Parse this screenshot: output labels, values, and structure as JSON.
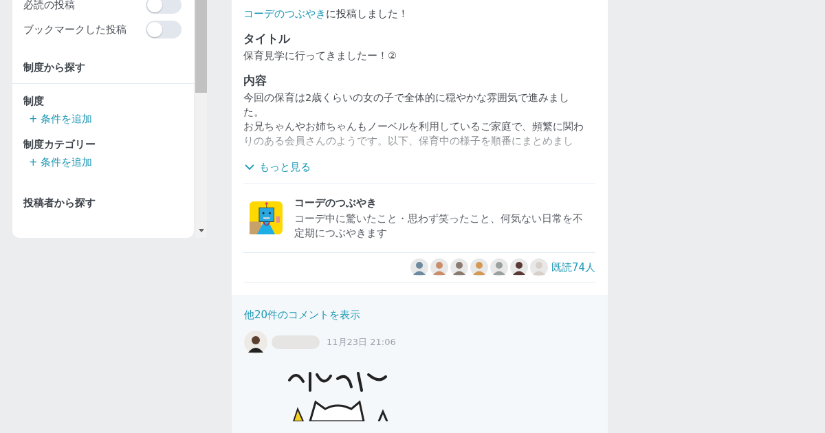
{
  "sidebar": {
    "toggles": [
      {
        "label": "必読の投稿",
        "on": false
      },
      {
        "label": "ブックマークした投稿",
        "on": false
      }
    ],
    "sections": [
      {
        "heading": "制度から探す",
        "filters": [
          {
            "label": "制度",
            "add_link": "+ 条件を追加"
          },
          {
            "label": "制度カテゴリー",
            "add_link": "+ 条件を追加"
          }
        ]
      },
      {
        "heading": "投稿者から探す"
      }
    ]
  },
  "post": {
    "channel_link": "コーデのつぶやき",
    "posted_text": "に投稿しました！",
    "fields": [
      {
        "heading": "タイトル",
        "lines": [
          "保育見学に行ってきましたー！②"
        ]
      },
      {
        "heading": "内容",
        "lines": [
          "今回の保育は2歳くらいの女の子で全体的に穏やかな雰囲気で進みました。",
          "お兄ちゃんやお姉ちゃんもノーベルを利用しているご家庭で、頻繁に関わりのある会員さんのようです。以下、保育中の様子を順番にまとめまし"
        ],
        "faded": true
      }
    ],
    "more_link": "もっと見る",
    "channel": {
      "name": "コーデのつぶやき",
      "description": "コーデ中に驚いたこと・思わず笑ったこと、何気ない日常を不定期につぶやきます"
    },
    "readers": {
      "label": "既読74人"
    }
  },
  "comments": {
    "more_link": "他20件のコメントを表示",
    "items": [
      {
        "time": "11月23日 21:06"
      }
    ]
  }
}
